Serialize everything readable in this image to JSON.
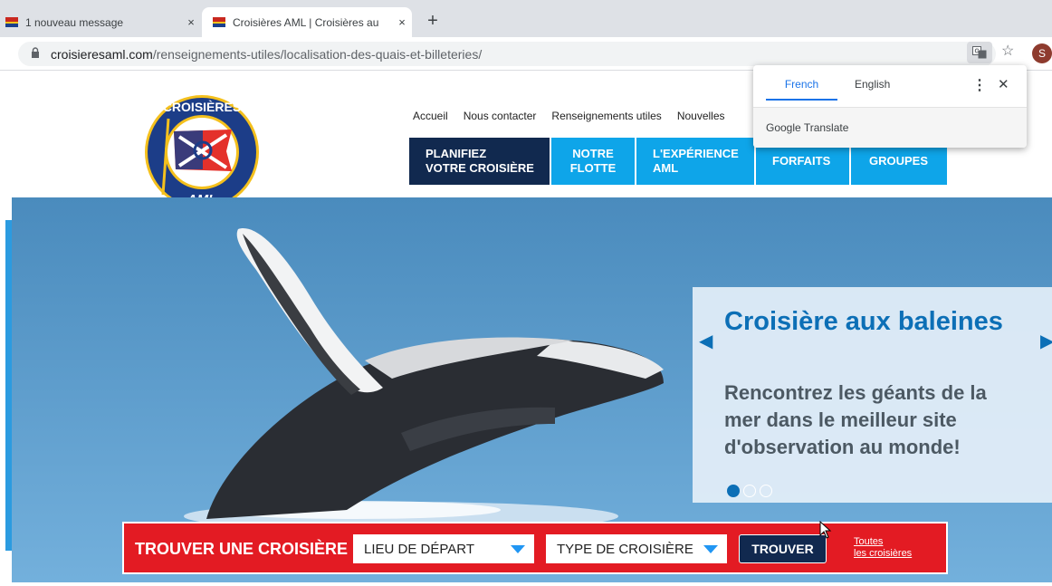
{
  "browser": {
    "tabs": [
      {
        "title": "1 nouveau message",
        "close": "×"
      },
      {
        "title": "Croisières AML | Croisières au",
        "close": "×"
      }
    ],
    "new_tab": "+",
    "url_domain": "croisieresaml.com",
    "url_path": "/renseignements-utiles/localisation-des-quais-et-billeteries/",
    "avatar": "S"
  },
  "translate_popup": {
    "tab_french": "French",
    "tab_english": "English",
    "brand": "Google Translate",
    "more": "⋮",
    "close": "✕"
  },
  "site": {
    "top_nav": [
      "Accueil",
      "Nous contacter",
      "Renseignements utiles",
      "Nouvelles"
    ],
    "main_nav": [
      {
        "line1": "PLANIFIEZ",
        "line2": "VOTRE CROISIÈRE"
      },
      {
        "line1": "NOTRE",
        "line2": "FLOTTE"
      },
      {
        "line1": "L'EXPÉRIENCE",
        "line2": "AML"
      },
      {
        "line1": "FORFAITS",
        "line2": ""
      },
      {
        "line1": "GROUPES",
        "line2": ""
      }
    ],
    "logo_text_top": "CROISIÈRES",
    "logo_text_bottom": "AML"
  },
  "hero": {
    "title": "Croisière aux baleines",
    "subtitle": "Rencontrez les géants de la mer dans le meilleur site d'observation au monde!",
    "active_slide": 1,
    "slide_count": 3
  },
  "finder": {
    "label": "TROUVER UNE CROISIÈRE",
    "departure": "LIEU DE DÉPART",
    "cruise_type": "TYPE DE CROISIÈRE",
    "button": "TROUVER",
    "all_line1": "Toutes",
    "all_line2": "les croisières"
  },
  "colors": {
    "nav_dark": "#11294f",
    "nav_blue": "#0ea5e9",
    "finder_red": "#e31b23",
    "hero_title": "#0c6fb6"
  }
}
